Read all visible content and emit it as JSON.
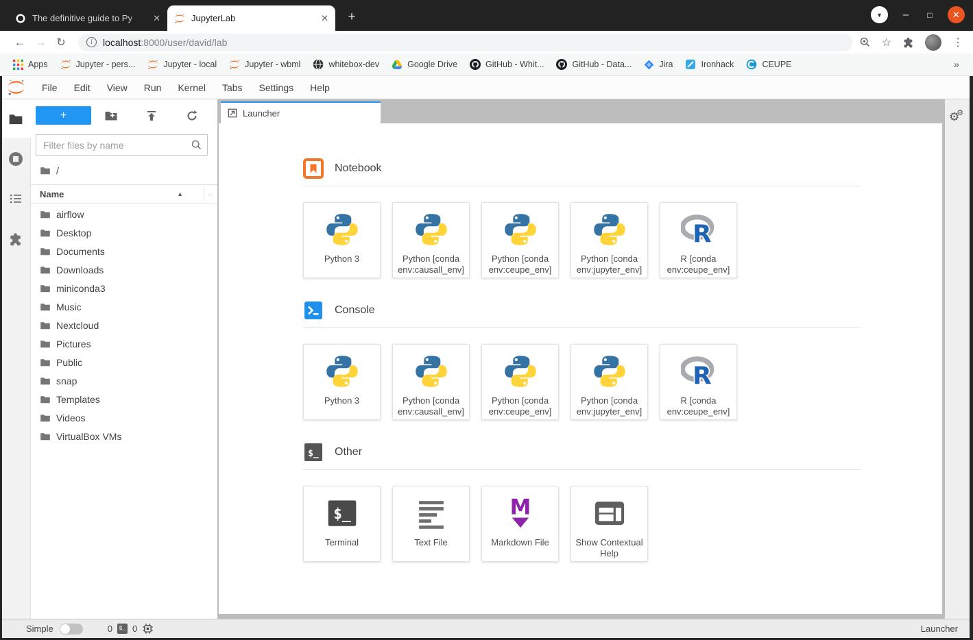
{
  "browser": {
    "tabs": [
      {
        "title": "The definitive guide to Py",
        "icon": "oreilly",
        "active": false
      },
      {
        "title": "JupyterLab",
        "icon": "jupyter",
        "active": true
      }
    ],
    "url": {
      "host": "localhost",
      "path": ":8000/user/david/lab"
    },
    "bookmarks": [
      {
        "label": "Apps",
        "icon": "apps-grid"
      },
      {
        "label": "Jupyter - pers...",
        "icon": "jupyter"
      },
      {
        "label": "Jupyter - local",
        "icon": "jupyter"
      },
      {
        "label": "Jupyter - wbml",
        "icon": "jupyter"
      },
      {
        "label": "whitebox-dev",
        "icon": "globe-dark"
      },
      {
        "label": "Google Drive",
        "icon": "gdrive"
      },
      {
        "label": "GitHub - Whit...",
        "icon": "github"
      },
      {
        "label": "GitHub - Data...",
        "icon": "github"
      },
      {
        "label": "Jira",
        "icon": "jira"
      },
      {
        "label": "Ironhack",
        "icon": "ironhack"
      },
      {
        "label": "CEUPE",
        "icon": "ceupe"
      }
    ],
    "overflow_chevron": "»"
  },
  "jupyter": {
    "menu": [
      "File",
      "Edit",
      "View",
      "Run",
      "Kernel",
      "Tabs",
      "Settings",
      "Help"
    ],
    "filebrowser": {
      "filter_placeholder": "Filter files by name",
      "breadcrumb_root": "/",
      "name_header": "Name",
      "ellipsis": "...",
      "items": [
        "airflow",
        "Desktop",
        "Documents",
        "Downloads",
        "miniconda3",
        "Music",
        "Nextcloud",
        "Pictures",
        "Public",
        "snap",
        "Templates",
        "Videos",
        "VirtualBox VMs"
      ]
    },
    "launcher": {
      "tab_label": "Launcher",
      "sections": [
        {
          "title": "Notebook",
          "icon": "notebook-orange",
          "cards": [
            {
              "label": "Python 3",
              "icon": "python"
            },
            {
              "label": "Python [conda env:causall_env]",
              "icon": "python"
            },
            {
              "label": "Python [conda env:ceupe_env]",
              "icon": "python"
            },
            {
              "label": "Python [conda env:jupyter_env]",
              "icon": "python"
            },
            {
              "label": "R [conda env:ceupe_env]",
              "icon": "r-logo"
            }
          ]
        },
        {
          "title": "Console",
          "icon": "console-blue",
          "cards": [
            {
              "label": "Python 3",
              "icon": "python"
            },
            {
              "label": "Python [conda env:causall_env]",
              "icon": "python"
            },
            {
              "label": "Python [conda env:ceupe_env]",
              "icon": "python"
            },
            {
              "label": "Python [conda env:jupyter_env]",
              "icon": "python"
            },
            {
              "label": "R [conda env:ceupe_env]",
              "icon": "r-logo"
            }
          ]
        },
        {
          "title": "Other",
          "icon": "terminal-dark",
          "cards": [
            {
              "label": "Terminal",
              "icon": "terminal-card"
            },
            {
              "label": "Text File",
              "icon": "text-file"
            },
            {
              "label": "Markdown File",
              "icon": "markdown"
            },
            {
              "label": "Show Contextual Help",
              "icon": "contextual-help"
            }
          ]
        }
      ]
    },
    "statusbar": {
      "mode_label": "Simple",
      "terminals_count": "0",
      "kernels_count": "0",
      "context_label": "Launcher"
    }
  },
  "colors": {
    "accent_blue": "#2196f3",
    "jupyter_orange": "#f37726",
    "close_button_orange": "#e95420",
    "dock_gray": "#bdbdbd"
  }
}
